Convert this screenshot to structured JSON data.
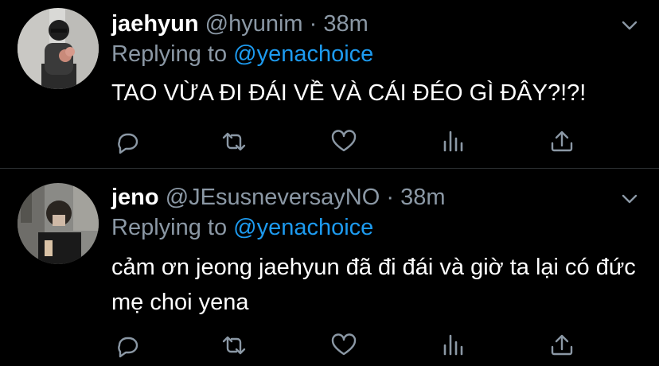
{
  "colors": {
    "background": "#000000",
    "text": "#ffffff",
    "muted": "#8b98a5",
    "link": "#1d9bf0",
    "divider": "#2f3336"
  },
  "tweets": [
    {
      "display_name": "jaehyun",
      "handle": "@hyunim",
      "separator": "·",
      "time": "38m",
      "replying_label": "Replying to",
      "replying_to": "@yenachoice",
      "text": "TAO VỪA ĐI ĐÁI VỀ VÀ CÁI ĐÉO GÌ ĐÂY?!?!",
      "icons": [
        "more-caret-icon",
        "reply-icon",
        "retweet-icon",
        "like-icon",
        "analytics-icon",
        "share-icon"
      ]
    },
    {
      "display_name": "jeno",
      "handle": "@JEsusneversayNO",
      "separator": "·",
      "time": "38m",
      "replying_label": "Replying to",
      "replying_to": "@yenachoice",
      "text": "cảm ơn jeong jaehyun đã đi đái và giờ ta lại có đức mẹ choi yena",
      "icons": [
        "more-caret-icon",
        "reply-icon",
        "retweet-icon",
        "like-icon",
        "analytics-icon",
        "share-icon"
      ]
    }
  ]
}
